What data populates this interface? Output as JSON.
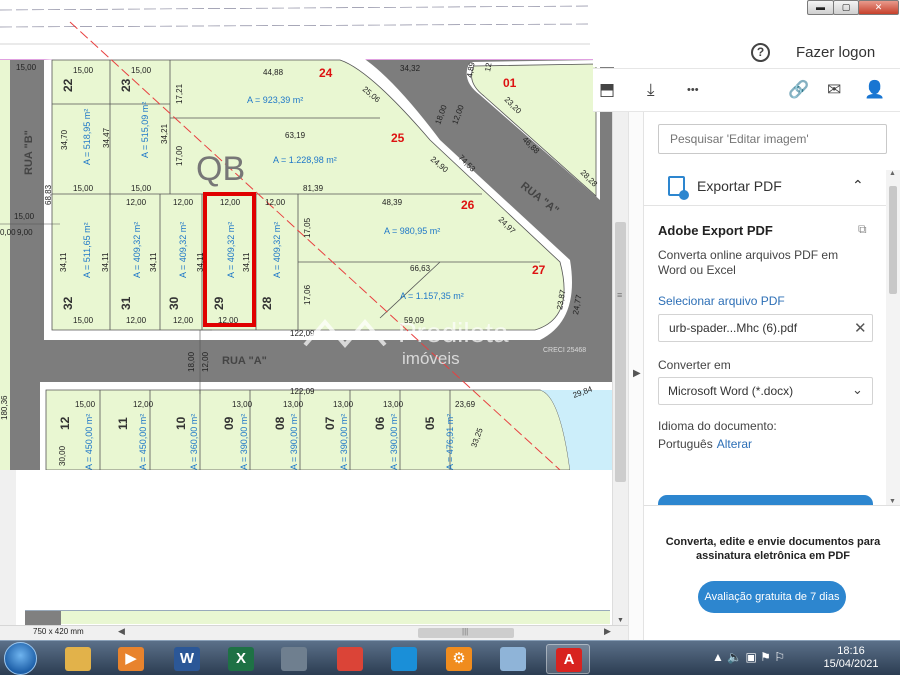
{
  "plan": {
    "block_label": "QB",
    "lots": {
      "l24": "24",
      "l01": "01",
      "l25": "25",
      "l26": "26",
      "l27": "27",
      "l22": "22",
      "l23": "23",
      "l32": "32",
      "l31": "31",
      "l30": "30",
      "l29": "29",
      "l28": "28",
      "l12": "12",
      "l11": "11",
      "l10": "10",
      "l09": "09",
      "l08": "08",
      "l07": "07",
      "l06": "06",
      "l05": "05"
    },
    "streets": {
      "rua_b": "RUA \"B\"",
      "rua_a_diag": "RUA \"A\"",
      "rua_a": "RUA \"A\""
    },
    "areas": {
      "a24": "A = 923,39 m²",
      "a25": "A = 1.228,98 m²",
      "a26": "A = 980,95 m²",
      "a27": "A = 1.157,35 m²",
      "a22": "A = 518,95 m²",
      "a23": "A = 515,09 m²",
      "a32": "A = 511,65 m²",
      "a31": "A = 409,32 m²",
      "a30": "A = 409,32 m²",
      "a29": "A = 409,32 m²",
      "a28": "A = 409,32 m²",
      "a12": "A = 450,00 m²",
      "a11": "A = 450,00 m²",
      "a10": "A = 360,00 m²",
      "a09": "A = 390,00 m²",
      "a08": "A = 390,00 m²",
      "a07": "A = 390,00 m²",
      "a06": "A = 390,00 m²",
      "a05": "A = 476,91 m²"
    },
    "dims": {
      "d1500a": "15,00",
      "d1500b": "15,00",
      "d4488": "44,88",
      "d3432": "34,32",
      "d489": "4,89",
      "d12": "12",
      "d3470": "34,70",
      "d3447": "34,47",
      "d3421": "34,21",
      "d1721": "17,21",
      "d2506": "25,06",
      "d1800": "18,00",
      "d1200r": "12,00",
      "d2320": "23,20",
      "d6319": "63,19",
      "d1700": "17,00",
      "d2490": "24,90",
      "d7453": "74,53",
      "d4688": "46,88",
      "d2828": "28,28",
      "d1500c": "15,00",
      "d1500d": "15,00",
      "d8139": "81,39",
      "d6883": "68,83",
      "d1500e": "15,00",
      "d900": "9,00",
      "d1200a": "12,00",
      "d1200b": "12,00",
      "d1200c": "12,00",
      "d1200d": "12,00",
      "d4839": "48,39",
      "d2497": "24,97",
      "d1705": "17,05",
      "d3411a": "34,11",
      "d3411b": "34,11",
      "d3411c": "34,11",
      "d3411d": "34,11",
      "d3411e": "34,11",
      "d6663": "66,63",
      "d1706": "17,06",
      "d2387": "23,87",
      "d2477": "24,77",
      "d1500f": "15,00",
      "d1200e": "12,00",
      "d1200f": "12,00",
      "d1200g": "12,00",
      "d5909": "59,09",
      "d12209a": "122,09",
      "d1800b": "18,00",
      "d1200h": "12,00",
      "d12209b": "122,09",
      "d2984": "29,84",
      "d18036": "180,36",
      "d1500g": "15,00",
      "d1500h": "15,00",
      "d1200i": "12,00",
      "d1300a": "13,00",
      "d1300b": "13,00",
      "d1300c": "13,00",
      "d1300d": "13,00",
      "d2369": "23,69",
      "d3325": "33,25",
      "d3000": "30,00",
      "d000": "0,00"
    },
    "watermark": {
      "name": "Predileta",
      "sub": "imóveis",
      "creci": "CRECI 25468"
    }
  },
  "viewer": {
    "dimensions": "750 x 420 mm"
  },
  "window": {
    "min": "▬",
    "max": "▢",
    "close": "✕"
  },
  "acrobat": {
    "help": "?",
    "logon": "Fazer logon",
    "toolbar": {
      "tool1": "⬒",
      "tool2": "⤓",
      "more": "•••",
      "link": "🔗",
      "mail": "✉",
      "share": "👤"
    },
    "search_placeholder": "Pesquisar 'Editar imagem'",
    "export_title": "Exportar PDF",
    "export_chevron": "⌃",
    "adobe_export": "Adobe Export PDF",
    "description": "Converta online arquivos PDF em Word ou Excel",
    "select_file": "Selecionar arquivo PDF",
    "file_name": "urb-spader...Mhc (6).pdf",
    "file_remove": "✕",
    "convert_label": "Converter em",
    "convert_value": "Microsoft Word (*.docx)",
    "convert_chevron": "⌄",
    "language_label": "Idioma do documento:",
    "language_value": "Português",
    "language_change": "Alterar",
    "promo": "Converta, edite e envie documentos para assinatura eletrônica em PDF",
    "trial_button": "Avaliação gratuita de 7 dias"
  },
  "taskbar": {
    "apps": [
      {
        "name": "explorer",
        "color": "#e2b24a",
        "glyph": ""
      },
      {
        "name": "media",
        "color": "#e8832d",
        "glyph": "▶"
      },
      {
        "name": "word",
        "color": "#2b5797",
        "glyph": "W"
      },
      {
        "name": "excel",
        "color": "#1e7145",
        "glyph": "X"
      },
      {
        "name": "scanner",
        "color": "#6f7f8f",
        "glyph": ""
      },
      {
        "name": "chrome",
        "color": "#db4437",
        "glyph": ""
      },
      {
        "name": "edge",
        "color": "#1a8fd8",
        "glyph": ""
      },
      {
        "name": "gear",
        "color": "#f08c1e",
        "glyph": "⚙"
      },
      {
        "name": "paint",
        "color": "#8fb4d8",
        "glyph": ""
      },
      {
        "name": "acrobat",
        "color": "#d8231f",
        "glyph": "A"
      }
    ],
    "tray": "▲  🔈  ▣  ⚑  ⚐",
    "time": "18:16",
    "date": "15/04/2021"
  }
}
